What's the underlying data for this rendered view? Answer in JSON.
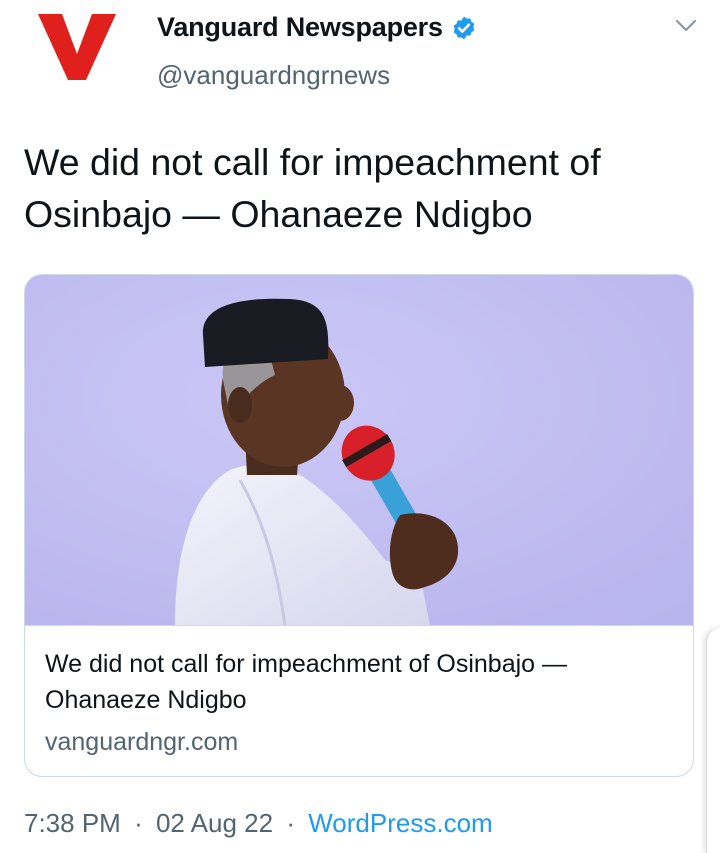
{
  "tweet": {
    "author_name": "Vanguard Newspapers",
    "handle": "@vanguardngrnews",
    "verified": true,
    "text": "We did not call for impeachment of Osinbajo — Ohanaeze Ndigbo",
    "time": "7:38 PM",
    "date": "02 Aug 22",
    "source": "WordPress.com",
    "separator": "·"
  },
  "card": {
    "title": "We did not call for impeachment of Osinbajo — Ohanaeze Ndigbo",
    "domain": "vanguardngr.com",
    "image_icon": "photo-of-speaker-with-microphone"
  },
  "icons": {
    "logo": "vanguard-logo-icon",
    "verified": "verified-badge-icon",
    "menu": "chevron-down-icon"
  },
  "colors": {
    "brand_red": "#e0201d",
    "verified_blue": "#1d9bf0",
    "link_blue": "#1d9bf0",
    "secondary_text": "#536471",
    "image_background": "#c7c3f2"
  }
}
